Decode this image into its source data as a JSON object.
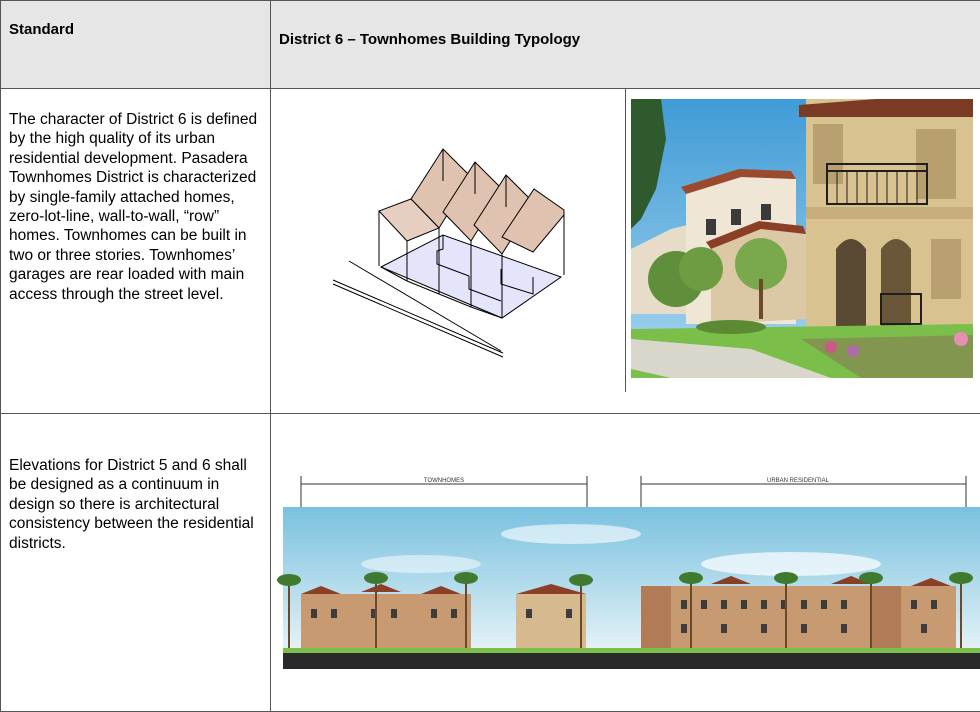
{
  "header": {
    "left_title": "Standard",
    "right_title": "District 6 – Townhomes Building Typology"
  },
  "row1": {
    "description": "The character of District 6 is defined by the high quality of its urban residential development. Pasadera Townhomes District is characterized by single-family attached homes, zero-lot-line, wall-to-wall, “row” homes. Townhomes can be built in two or three stories. Townhomes’ garages are rear loaded with main access through the street level.",
    "diagram_icon": "isometric-townhome-massing-icon",
    "photo_icon": "townhomes-street-photo"
  },
  "row2": {
    "description": "Elevations for District 5 and 6 shall be designed as a continuum in design so there is architectural consistency between the residential districts.",
    "elevation": {
      "label_left": "TOWNHOMES",
      "label_right": "URBAN RESIDENTIAL"
    }
  },
  "colors": {
    "header_bg": "#e6e6e6",
    "roof_fill": "#dfc2b0",
    "floor_fill": "#e4e4fa",
    "sky": "#8ec9e4",
    "stucco": "#c89a72",
    "grass": "#7bbf4a"
  }
}
